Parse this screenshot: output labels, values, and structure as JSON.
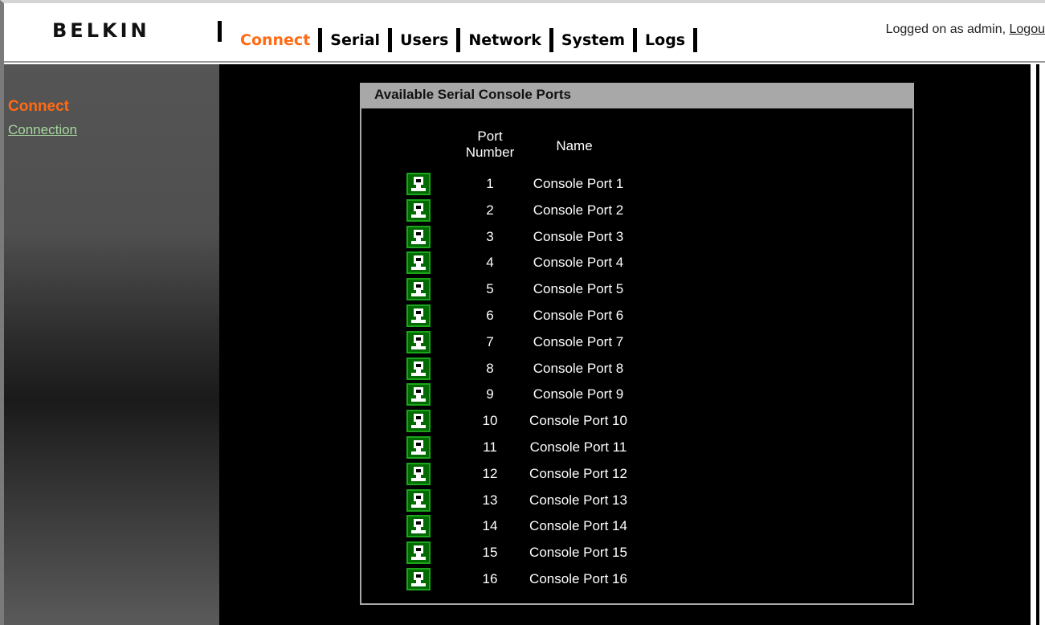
{
  "header": {
    "logo": "BELKIN",
    "nav": [
      {
        "label": "Connect",
        "active": true
      },
      {
        "label": "Serial",
        "active": false
      },
      {
        "label": "Users",
        "active": false
      },
      {
        "label": "Network",
        "active": false
      },
      {
        "label": "System",
        "active": false
      },
      {
        "label": "Logs",
        "active": false
      }
    ],
    "login_text": "Logged on as admin, ",
    "logout_label": "Logou"
  },
  "sidebar": {
    "title": "Connect",
    "link": "Connection"
  },
  "panel": {
    "title": "Available Serial Console Ports",
    "col_port": "Port\nNumber",
    "col_port_line1": "Port",
    "col_port_line2": "Number",
    "col_name": "Name",
    "rows": [
      {
        "num": "1",
        "name": "Console Port 1"
      },
      {
        "num": "2",
        "name": "Console Port 2"
      },
      {
        "num": "3",
        "name": "Console Port 3"
      },
      {
        "num": "4",
        "name": "Console Port 4"
      },
      {
        "num": "5",
        "name": "Console Port 5"
      },
      {
        "num": "6",
        "name": "Console Port 6"
      },
      {
        "num": "7",
        "name": "Console Port 7"
      },
      {
        "num": "8",
        "name": "Console Port 8"
      },
      {
        "num": "9",
        "name": "Console Port 9"
      },
      {
        "num": "10",
        "name": "Console Port 10"
      },
      {
        "num": "11",
        "name": "Console Port 11"
      },
      {
        "num": "12",
        "name": "Console Port 12"
      },
      {
        "num": "13",
        "name": "Console Port 13"
      },
      {
        "num": "14",
        "name": "Console Port 14"
      },
      {
        "num": "15",
        "name": "Console Port 15"
      },
      {
        "num": "16",
        "name": "Console Port 16"
      }
    ],
    "icon": "terminal-icon"
  },
  "colors": {
    "accent": "#ff6a13",
    "link": "#a8d8a0",
    "panel_border": "#a8a8a8",
    "icon_bg": "#006a00"
  }
}
